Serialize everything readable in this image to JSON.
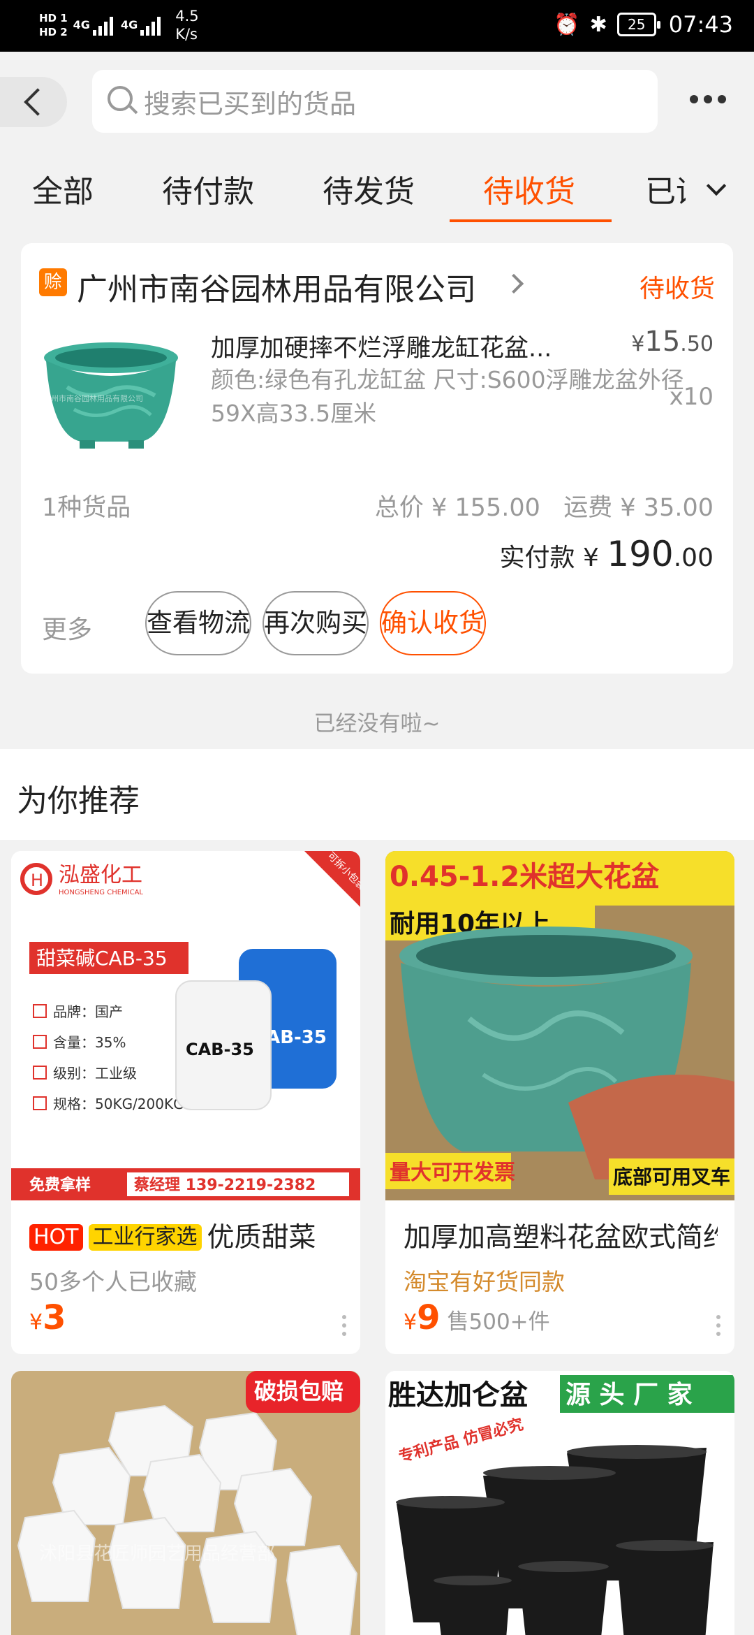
{
  "status_bar": {
    "sim1": "HD 1",
    "sim2": "HD 2",
    "net1": "4G",
    "net2": "4G",
    "speed": "4.5\nK/s",
    "battery": "25",
    "time": "07:43"
  },
  "header": {
    "search_placeholder": "搜索已买到的货品"
  },
  "tabs": [
    {
      "label": "全部",
      "active": false
    },
    {
      "label": "待付款",
      "active": false
    },
    {
      "label": "待发货",
      "active": false
    },
    {
      "label": "待收货",
      "active": true
    },
    {
      "label": "已评价",
      "active": false
    }
  ],
  "order": {
    "shop_badge": "赊",
    "shop_name": "广州市南谷园林用品有限公司",
    "status": "待收货",
    "product_title": "加厚加硬摔不烂浮雕龙缸花盆...",
    "product_spec": "颜色:绿色有孔龙缸盆 尺寸:S600浮雕龙盆外径59X高33.5厘米",
    "image_watermark": "广州市南谷园林用品有限公司",
    "price_symbol": "¥",
    "price_int": "15",
    "price_dec": ".50",
    "qty": "x10",
    "kinds": "1种货品",
    "total": "总价 ¥ 155.00",
    "shipping": "运费 ¥ 35.00",
    "paid_label": "实付款 ¥ ",
    "paid_int": "190",
    "paid_dec": ".00",
    "more": "更多",
    "btn_logistics": "查看物流",
    "btn_rebuy": "再次购买",
    "btn_confirm": "确认收货"
  },
  "no_more": "已经没有啦~",
  "recommend": {
    "title": "为你推荐",
    "items": [
      {
        "tag_hot": "HOT",
        "tag_biz": "工业行家选",
        "name": "优质甜菜",
        "sub": "50多个人已收藏",
        "price_symbol": "¥",
        "price": "3",
        "img": {
          "brand": "泓盛化工",
          "brand_en": "HONGSHENG CHEMICAL",
          "corner": "可拆小包装",
          "product": "甜菜碱CAB-35",
          "drum_white": "CAB-35",
          "drum_blue": "CAB-35",
          "specs": [
            "品牌：国产",
            "含量：35%",
            "级别：工业级",
            "规格：50KG/200KG"
          ],
          "free_sample": "免费拿样",
          "contact": "蔡经理 139-2219-2382"
        }
      },
      {
        "name": "加厚加高塑料花盆欧式简约",
        "sub": "淘宝有好货同款",
        "price_symbol": "¥",
        "price": "9",
        "sold": "售500+件",
        "img": {
          "banner": "0.45-1.2米超大花盆",
          "durable": "耐用10年以上",
          "bulk": "量大可开发票",
          "forklift": "底部可用叉车"
        }
      },
      {
        "img": {
          "badge": "破损包赔",
          "watermark": "沭阳县花匠师园艺用品经营部"
        }
      },
      {
        "img": {
          "brand": "胜达加仑盆",
          "source": "源 头 厂 家",
          "patent": "专利产品\n仿冒必究"
        }
      }
    ]
  },
  "colors": {
    "accent": "#ff5000",
    "badge_orange": "#ff7a00",
    "hot_red": "#ff2200",
    "biz_yellow": "#ffd400",
    "gold_text": "#d48a2c"
  }
}
